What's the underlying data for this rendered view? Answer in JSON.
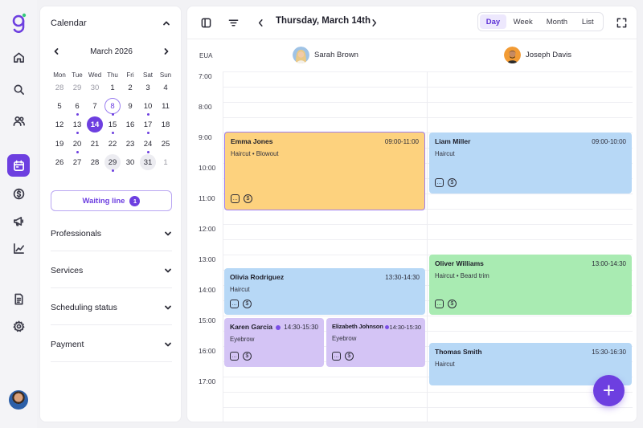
{
  "rail": {
    "items": [
      "home-icon",
      "search-icon",
      "users-icon",
      "calendar-icon",
      "dollar-icon",
      "megaphone-icon",
      "chart-icon",
      "document-icon",
      "settings-icon"
    ],
    "active": "calendar-icon"
  },
  "panel": {
    "title": "Calendar",
    "month_label": "March 2026",
    "weekdays": [
      "Mon",
      "Tue",
      "Wed",
      "Thu",
      "Fri",
      "Sat",
      "Sun"
    ],
    "weeks": [
      [
        "28",
        "29",
        "30",
        "1",
        "2",
        "3",
        "4"
      ],
      [
        "5",
        "6",
        "7",
        "8",
        "9",
        "10",
        "11"
      ],
      [
        "12",
        "13",
        "14",
        "15",
        "16",
        "17",
        "18"
      ],
      [
        "19",
        "20",
        "21",
        "22",
        "23",
        "24",
        "25"
      ],
      [
        "26",
        "27",
        "28",
        "29",
        "30",
        "31",
        "1"
      ]
    ],
    "today": "14",
    "selected": "8",
    "waiting_label": "Waiting line",
    "waiting_count": "1",
    "sections": [
      "Professionals",
      "Services",
      "Scheduling status",
      "Payment"
    ]
  },
  "toolbar": {
    "date": "Thursday, March 14th",
    "views": [
      "Day",
      "Week",
      "Month",
      "List"
    ],
    "active_view": "Day"
  },
  "timezone": "EUA",
  "staff": [
    {
      "name": "Sarah Brown"
    },
    {
      "name": "Joseph Davis"
    }
  ],
  "hours": [
    "7:00",
    "8:00",
    "9:00",
    "10:00",
    "11:00",
    "12:00",
    "13:00",
    "14:00",
    "15:00",
    "16:00",
    "17:00"
  ],
  "events": [
    {
      "client": "Emma Jones",
      "time": "09:00-11:00",
      "service": "Haircut • Blowout",
      "color": "#fdd27e"
    },
    {
      "client": "Liam Miller",
      "time": "09:00-10:00",
      "service": "Haircut",
      "color": "#b7d8f6"
    },
    {
      "client": "Olivia Rodriguez",
      "time": "13:30-14:30",
      "service": "Haircut",
      "color": "#b7d8f6"
    },
    {
      "client": "Oliver Williams",
      "time": "13:00-14:30",
      "service": "Haircut • Beard trim",
      "color": "#a9ebb2"
    },
    {
      "client": "Karen Garcia",
      "time": "14:30-15:30",
      "service": "Eyebrow",
      "color": "#d4c4f5"
    },
    {
      "client": "Elizabeth Johnson",
      "time": "14:30-15:30",
      "service": "Eyebrow",
      "color": "#d4c4f5"
    },
    {
      "client": "Thomas Smith",
      "time": "15:30-16:30",
      "service": "Haircut",
      "color": "#b7d8f6"
    }
  ],
  "fab_label": "+"
}
